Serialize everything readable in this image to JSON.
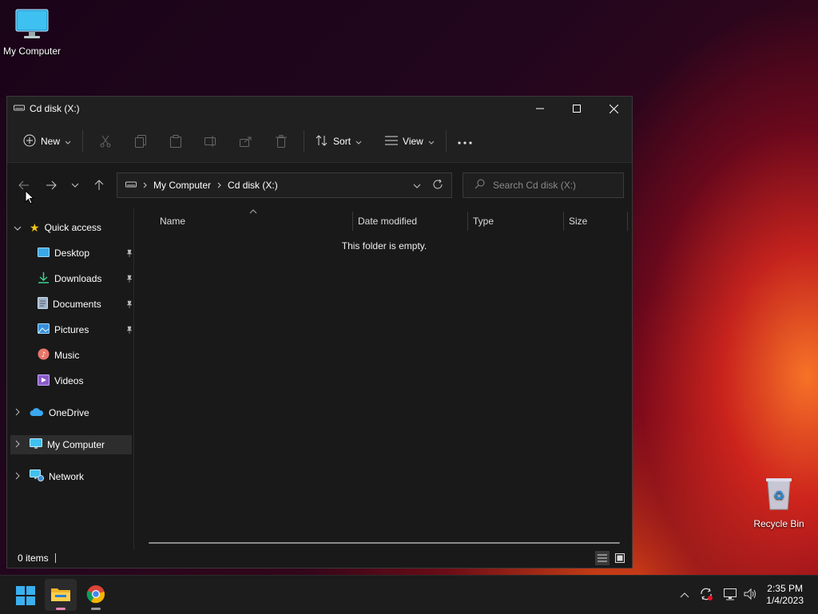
{
  "desktop": {
    "icons": [
      {
        "label": "My Computer",
        "icon": "monitor-icon"
      },
      {
        "label": "Recycle Bin",
        "icon": "recycle-bin-icon"
      }
    ]
  },
  "window": {
    "title": "Cd disk (X:)",
    "toolbar": {
      "new_label": "New",
      "sort_label": "Sort",
      "view_label": "View",
      "disabled_icons": [
        "cut-icon",
        "copy-icon",
        "paste-icon",
        "rename-icon",
        "share-icon",
        "delete-icon"
      ],
      "more": "more-options-icon"
    },
    "address": {
      "crumbs": [
        "My Computer",
        "Cd disk (X:)"
      ]
    },
    "search": {
      "placeholder": "Search Cd disk (X:)"
    },
    "nav": {
      "quick_access": "Quick access",
      "quick_items": [
        {
          "label": "Desktop",
          "pinned": true,
          "icon": "desktop-folder-icon"
        },
        {
          "label": "Downloads",
          "pinned": true,
          "icon": "download-icon"
        },
        {
          "label": "Documents",
          "pinned": true,
          "icon": "document-icon"
        },
        {
          "label": "Pictures",
          "pinned": true,
          "icon": "picture-icon"
        },
        {
          "label": "Music",
          "pinned": false,
          "icon": "music-icon"
        },
        {
          "label": "Videos",
          "pinned": false,
          "icon": "video-icon"
        }
      ],
      "onedrive": "OneDrive",
      "my_computer": "My Computer",
      "network": "Network"
    },
    "columns": [
      "Name",
      "Date modified",
      "Type",
      "Size"
    ],
    "empty_message": "This folder is empty.",
    "status": "0 items"
  },
  "taskbar": {
    "apps": [
      "start-icon",
      "file-explorer-icon",
      "chrome-icon"
    ],
    "tray_icons": [
      "chevron-up-icon",
      "sync-icon",
      "network-icon",
      "volume-icon"
    ],
    "time": "2:35 PM",
    "date": "1/4/2023"
  },
  "colors": {
    "window_bg": "#191919",
    "toolbar_bg": "#202020",
    "taskbar_bg": "#1c1c1c",
    "accent_blue": "#4cc2ff"
  }
}
